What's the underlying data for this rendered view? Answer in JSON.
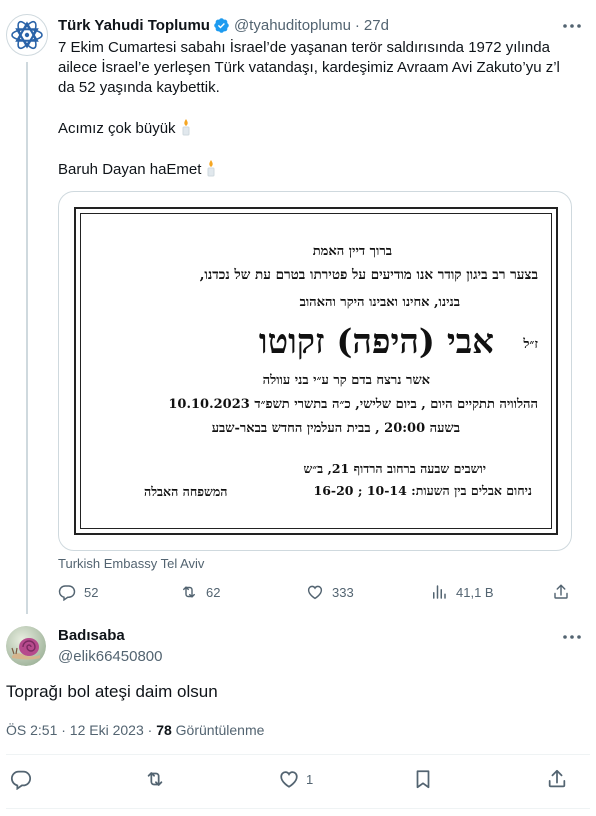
{
  "tweet": {
    "author_name": "Türk Yahudi Toplumu",
    "author_handle": "@tyahuditoplumu",
    "separator": "·",
    "time": "27d",
    "text_lines": [
      "7 Ekim Cumartesi sabahı İsrael’de yaşanan terör saldırısında 1972 yılında",
      "ailece İsrael’e yerleşen Türk vatandaşı, kardeşimiz Avraam Avi Zakuto’yu z’l",
      "da 52 yaşında kaybettik."
    ],
    "text_line2": "Acımız çok büyük",
    "text_line3": "Baruh Dayan haEmet",
    "media_notice": {
      "line1": "ברוך דיין האמת",
      "line2": "בצער רב ביגון קודר אנו מודיעים על פטירתו בטרם עת של נכדנו,",
      "line3": "בנינו, אחינו ואבינו היקר והאהוב",
      "name": "אבי (היפה) זקוטו",
      "honorific": "ז״ל",
      "line5": "אשר נרצח בדם קר ע״י בני עוולה",
      "line6": "ההלוויה תתקיים היום , ביום שלישי, כ״ה בתשרי תשפ״ד 10.10.2023",
      "line7": "בשעה 20:00 , בבית העלמין החדש בבאר-שבע",
      "line8": "יושבים שבעה ברחוב הרדוף 21, ב״ש",
      "line9": "ניחום אבלים בין השעות: 10-14 ; 16-20",
      "signature": "המשפחה האבלה"
    },
    "media_source": "Turkish Embassy Tel Aviv",
    "stats": {
      "replies": "52",
      "reposts": "62",
      "likes": "333",
      "views": "41,1 B"
    }
  },
  "reply": {
    "author_name": "Badısaba",
    "author_handle": "@elik66450800",
    "text": "Toprağı bol ateşi daim olsun",
    "timestamp": "ÖS 2:51 · 12 Eki 2023 · ",
    "views_count": "78",
    "views_label": " Görüntülenme",
    "likes": "1"
  },
  "icons": {
    "verified": "verified-badge-icon",
    "candle": "candle-icon",
    "more": "more-options-icon",
    "reply": "reply-icon",
    "repost": "repost-icon",
    "like": "like-icon",
    "views": "views-icon",
    "share": "share-icon",
    "bookmark": "bookmark-icon"
  },
  "colors": {
    "verified": "#1d9bf0",
    "muted": "#536471",
    "text": "#0f1419",
    "border": "#cfd9de"
  }
}
